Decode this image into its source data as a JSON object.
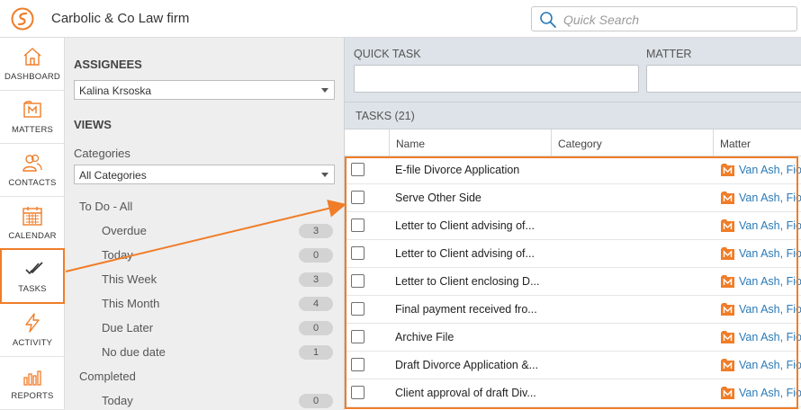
{
  "app": {
    "title": "Carbolic & Co Law firm"
  },
  "search": {
    "placeholder": "Quick Search"
  },
  "nav": [
    {
      "label": "DASHBOARD",
      "icon": "house-icon"
    },
    {
      "label": "MATTERS",
      "icon": "matters-icon"
    },
    {
      "label": "CONTACTS",
      "icon": "contacts-icon"
    },
    {
      "label": "CALENDAR",
      "icon": "calendar-icon"
    },
    {
      "label": "TASKS",
      "icon": "tasks-checkmark-icon",
      "active": true
    },
    {
      "label": "ACTIVITY",
      "icon": "lightning-icon"
    },
    {
      "label": "REPORTS",
      "icon": "bar-chart-icon"
    }
  ],
  "filters": {
    "assignees_heading": "ASSIGNEES",
    "assignee_value": "Kalina Krsoska",
    "views_heading": "VIEWS",
    "categories_label": "Categories",
    "categories_value": "All Categories",
    "todo_label": "To Do - All",
    "todo_items": [
      {
        "label": "Overdue",
        "count": "3"
      },
      {
        "label": "Today",
        "count": "0"
      },
      {
        "label": "This Week",
        "count": "3"
      },
      {
        "label": "This Month",
        "count": "4"
      },
      {
        "label": "Due Later",
        "count": "0"
      },
      {
        "label": "No due date",
        "count": "1"
      }
    ],
    "completed_label": "Completed",
    "completed_items": [
      {
        "label": "Today",
        "count": "0"
      }
    ]
  },
  "quick_task": {
    "label": "QUICK TASK",
    "matter_label": "MATTER"
  },
  "tasks": {
    "title": "TASKS (21)",
    "columns": [
      "Name",
      "Category",
      "Matter"
    ],
    "rows": [
      {
        "name": "E-file Divorce Application",
        "category": "",
        "matter": "Van Ash, Fio"
      },
      {
        "name": "Serve Other Side",
        "category": "",
        "matter": "Van Ash, Fio"
      },
      {
        "name": "Letter to Client advising of...",
        "category": "",
        "matter": "Van Ash, Fio"
      },
      {
        "name": "Letter to Client advising of...",
        "category": "",
        "matter": "Van Ash, Fio"
      },
      {
        "name": "Letter to Client enclosing D...",
        "category": "",
        "matter": "Van Ash, Fio"
      },
      {
        "name": "Final payment received fro...",
        "category": "",
        "matter": "Van Ash, Fio"
      },
      {
        "name": "Archive File",
        "category": "",
        "matter": "Van Ash, Fio"
      },
      {
        "name": "Draft Divorce Application &...",
        "category": "",
        "matter": "Van Ash, Fio"
      },
      {
        "name": "Client approval of draft Div...",
        "category": "",
        "matter": "Van Ash, Fio"
      }
    ]
  },
  "colors": {
    "accent": "#f07d28",
    "link": "#2a7ab8",
    "panel": "#eeeeee",
    "toolbar": "#dde3e8"
  }
}
